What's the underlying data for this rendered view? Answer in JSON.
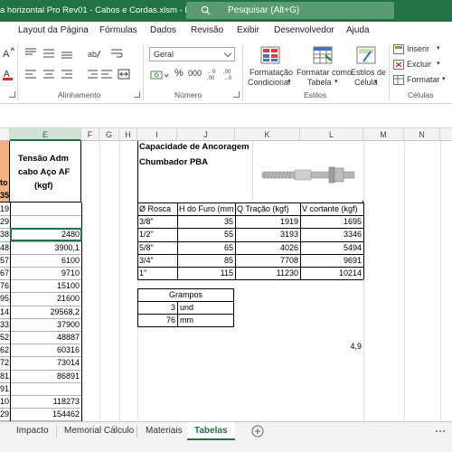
{
  "window": {
    "title": "a horizontal  Pro Rev01 - Cabos e Cordas.xlsm  -  Excel",
    "search_placeholder": "Pesquisar (Alt+G)"
  },
  "ribbon_tabs": [
    "Layout da Página",
    "Fórmulas",
    "Dados",
    "Revisão",
    "Exibir",
    "Desenvolvedor",
    "Ajuda"
  ],
  "ribbon": {
    "number_format": "Geral",
    "percent": "%",
    "thousands": "000",
    "conditional_formatting": [
      "Formatação",
      "Condicional"
    ],
    "format_as_table": [
      "Formatar como",
      "Tabela"
    ],
    "cell_styles": [
      "Estilos de",
      "Célula"
    ],
    "insert": "Inserir",
    "delete": "Excluir",
    "format": "Formatar",
    "groups": {
      "alignment": "Alinhamento",
      "number": "Número",
      "styles": "Estilos",
      "cells": "Células"
    }
  },
  "columns": [
    "E",
    "F",
    "G",
    "H",
    "I",
    "J",
    "K",
    "L",
    "M",
    "N"
  ],
  "left_table": {
    "header": [
      "Tensão Adm",
      "cabo Aço AF",
      "(kgf)"
    ],
    "partial_header": [
      "to",
      "35"
    ],
    "partial_column": [
      "19",
      "29",
      "38",
      "48",
      "57",
      "67",
      "76",
      "95",
      "14",
      "33",
      "52",
      "62",
      "72",
      "81",
      "91",
      "10",
      "29",
      "48",
      "67",
      "05"
    ],
    "values": [
      "",
      "",
      "2480",
      "3900,1",
      "6100",
      "9710",
      "15100",
      "21600",
      "29568,2",
      "37900",
      "48887",
      "60316",
      "73014",
      "86891",
      "",
      "118273",
      "154462"
    ]
  },
  "anchor_table": {
    "title_line1": "Capacidade de Ancoragem",
    "title_line2": "Chumbador PBA",
    "headers": [
      "Ø Rosca",
      "H do Furo (mm)",
      "Q Tração (kgf)",
      "V cortante (kgf)"
    ],
    "rows": [
      [
        "3/8\"",
        "35",
        "1919",
        "1695"
      ],
      [
        "1/2\"",
        "55",
        "3193",
        "3346"
      ],
      [
        "5/8\"",
        "65",
        "4026",
        "5494"
      ],
      [
        "3/4\"",
        "85",
        "7708",
        "9691"
      ],
      [
        "1\"",
        "115",
        "11230",
        "10214"
      ]
    ]
  },
  "grampos": {
    "title": "Grampos",
    "rows": [
      [
        "3",
        "und"
      ],
      [
        "76",
        "mm"
      ]
    ]
  },
  "loose_value": "4,9",
  "sheet_tabs": [
    "Impacto",
    "Memorial Cálculo",
    "Materiais",
    "Tabelas"
  ],
  "active_sheet": "Tabelas",
  "colors": {
    "excel_green": "#217346",
    "salmon": "#f4b183"
  }
}
